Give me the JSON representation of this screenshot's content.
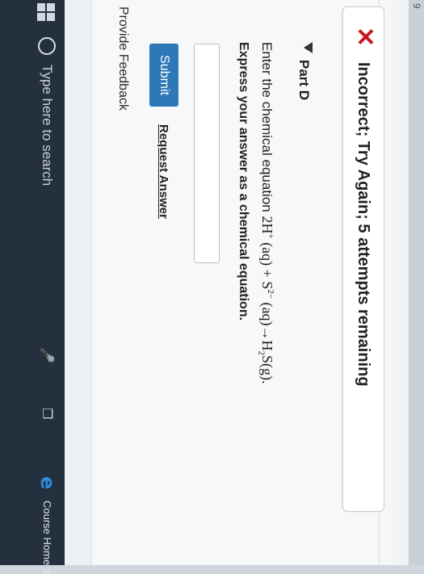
{
  "bezel_fragment": "9",
  "alert": {
    "icon": "close-icon",
    "message": "Incorrect; Try Again; 5 attempts remaining",
    "color": "#c8171e"
  },
  "part": {
    "label": "Part D"
  },
  "question": {
    "prefix": "Enter the chemical equation ",
    "equation": {
      "t1": "2H",
      "t1_sup": "+",
      "t2": " (aq) + S",
      "t2_sup": "2−",
      "t3": " (aq)→H",
      "t3_sub": "2",
      "t4": "S(g)."
    },
    "instruction": "Express your answer as a chemical equation."
  },
  "answer": {
    "value": ""
  },
  "buttons": {
    "submit": "Submit",
    "request": "Request Answer"
  },
  "feedback": "Provide Feedback",
  "taskbar": {
    "search_placeholder": "Type here to search",
    "course_label": "Course Home a"
  },
  "colors": {
    "accent": "#2e78b7",
    "taskbar": "#24303d",
    "error": "#c8171e"
  }
}
